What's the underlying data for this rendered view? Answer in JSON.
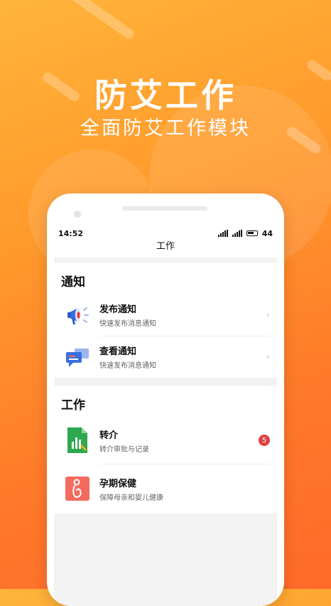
{
  "hero": {
    "title": "防艾工作",
    "subtitle": "全面防艾工作模块"
  },
  "phone": {
    "status": {
      "time": "14:52",
      "battery": "44"
    },
    "nav_title": "工作",
    "sections": [
      {
        "title": "通知",
        "items": [
          {
            "label": "发布通知",
            "desc": "快速发布消息通知",
            "icon": "megaphone-icon"
          },
          {
            "label": "查看通知",
            "desc": "快速发布消息通知",
            "icon": "chat-bubbles-icon"
          }
        ]
      },
      {
        "title": "工作",
        "items": [
          {
            "label": "转介",
            "desc": "转介审批与记录",
            "icon": "spreadsheet-icon",
            "badge": "5"
          },
          {
            "label": "孕期保健",
            "desc": "保障母亲和婴儿健康",
            "icon": "pregnancy-icon"
          }
        ]
      }
    ]
  },
  "colors": {
    "accent": "#ff8a2a",
    "badge": "#e04040"
  }
}
